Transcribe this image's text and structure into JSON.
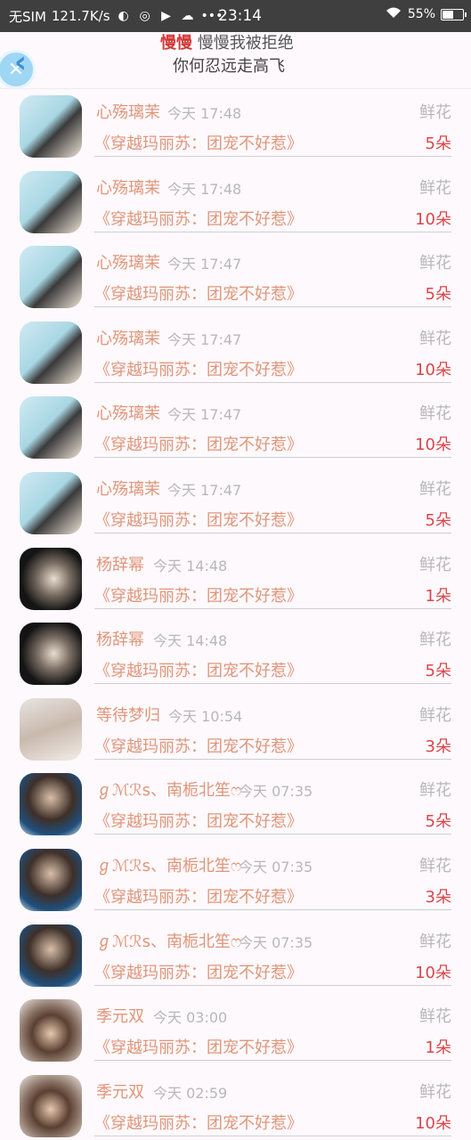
{
  "status_bar": {
    "carrier": "无SIM",
    "speed": "121.7K/s",
    "time": "23:14",
    "battery": "55%",
    "battery_level": 0.55
  },
  "header": {
    "back_icon": "chevron-left-icon",
    "marquee_highlight": "慢慢",
    "marquee_line1": "慢慢我被拒绝",
    "marquee_line2": "你何忍远走高飞"
  },
  "list": [
    {
      "avatar": "a1",
      "name": "心殇璃茉",
      "time": "今天 17:48",
      "gift": "鲜花",
      "book": "《穿越玛丽苏：团宠不好惹》",
      "count": "5朵"
    },
    {
      "avatar": "a1",
      "name": "心殇璃茉",
      "time": "今天 17:48",
      "gift": "鲜花",
      "book": "《穿越玛丽苏：团宠不好惹》",
      "count": "10朵"
    },
    {
      "avatar": "a1",
      "name": "心殇璃茉",
      "time": "今天 17:47",
      "gift": "鲜花",
      "book": "《穿越玛丽苏：团宠不好惹》",
      "count": "5朵"
    },
    {
      "avatar": "a1",
      "name": "心殇璃茉",
      "time": "今天 17:47",
      "gift": "鲜花",
      "book": "《穿越玛丽苏：团宠不好惹》",
      "count": "10朵"
    },
    {
      "avatar": "a1",
      "name": "心殇璃茉",
      "time": "今天 17:47",
      "gift": "鲜花",
      "book": "《穿越玛丽苏：团宠不好惹》",
      "count": "10朵"
    },
    {
      "avatar": "a1",
      "name": "心殇璃茉",
      "time": "今天 17:47",
      "gift": "鲜花",
      "book": "《穿越玛丽苏：团宠不好惹》",
      "count": "5朵"
    },
    {
      "avatar": "a2",
      "name": "杨辞幂",
      "time": "今天 14:48",
      "gift": "鲜花",
      "book": "《穿越玛丽苏：团宠不好惹》",
      "count": "1朵"
    },
    {
      "avatar": "a2",
      "name": "杨辞幂",
      "time": "今天 14:48",
      "gift": "鲜花",
      "book": "《穿越玛丽苏：团宠不好惹》",
      "count": "5朵"
    },
    {
      "avatar": "a3",
      "name": "等待梦归",
      "time": "今天 10:54",
      "gift": "鲜花",
      "book": "《穿越玛丽苏：团宠不好惹》",
      "count": "3朵"
    },
    {
      "avatar": "a4",
      "name": "ℊℳℛs、南栀北笙ෆ",
      "time": "今天 07:35",
      "gift": "鲜花",
      "book": "《穿越玛丽苏：团宠不好惹》",
      "count": "5朵"
    },
    {
      "avatar": "a4",
      "name": "ℊℳℛs、南栀北笙ෆ",
      "time": "今天 07:35",
      "gift": "鲜花",
      "book": "《穿越玛丽苏：团宠不好惹》",
      "count": "3朵"
    },
    {
      "avatar": "a4",
      "name": "ℊℳℛs、南栀北笙ෆ",
      "time": "今天 07:35",
      "gift": "鲜花",
      "book": "《穿越玛丽苏：团宠不好惹》",
      "count": "10朵"
    },
    {
      "avatar": "a5",
      "name": "季元双",
      "time": "今天 03:00",
      "gift": "鲜花",
      "book": "《穿越玛丽苏：团宠不好惹》",
      "count": "1朵"
    },
    {
      "avatar": "a5",
      "name": "季元双",
      "time": "今天 02:59",
      "gift": "鲜花",
      "book": "《穿越玛丽苏：团宠不好惹》",
      "count": "10朵"
    }
  ]
}
